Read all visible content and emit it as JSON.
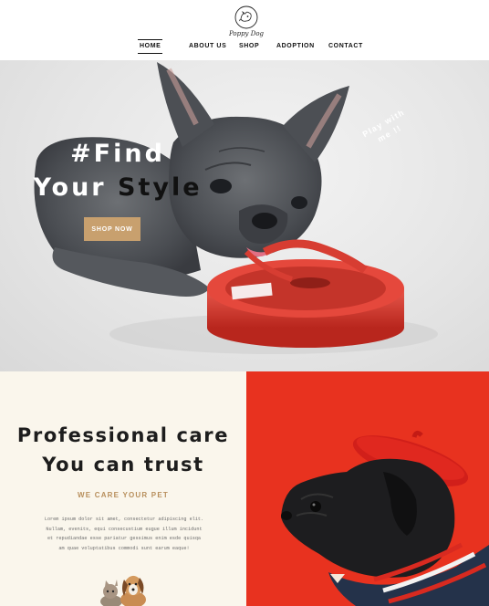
{
  "brand": {
    "logo_text": "Poppy Dog",
    "logo_icon": "dog-head-icon"
  },
  "nav": {
    "items": [
      {
        "label": "HOME",
        "active": true
      },
      {
        "label": "ABOUT US",
        "active": false
      },
      {
        "label": "SHOP",
        "active": false
      },
      {
        "label": "ADOPTION",
        "active": false
      },
      {
        "label": "CONTACT",
        "active": false
      }
    ]
  },
  "hero": {
    "title_line1": "#Find",
    "title_line2_a": "Your ",
    "title_line2_b": "Style",
    "button_label": "SHOP NOW",
    "play_line1": "Play with",
    "play_line2": "me !!",
    "image": "french-bulldog-with-red-ribbon-spool"
  },
  "care": {
    "title_line1": "Professional care",
    "title_line2": "You can trust",
    "subtitle": "WE CARE YOUR PET",
    "body_lines": [
      "Lorem ipsum dolor sit amet, consectetur adipiscing elit.",
      "Nullam, evenits, equi consecustium eugue illum incidunt",
      "et repudiandae esse pariatur gessimus enim esde quisqa",
      "am quae voluptatibus commodi sunt earum eaque!"
    ],
    "illustration": "dog-and-cat-illustration"
  },
  "feature_image": "black-pug-wearing-red-beret",
  "colors": {
    "accent": "#c8a06e",
    "care_bg": "#faf6ec",
    "pug_bg": "#e8321f",
    "text_dark": "#1d1d1d"
  }
}
